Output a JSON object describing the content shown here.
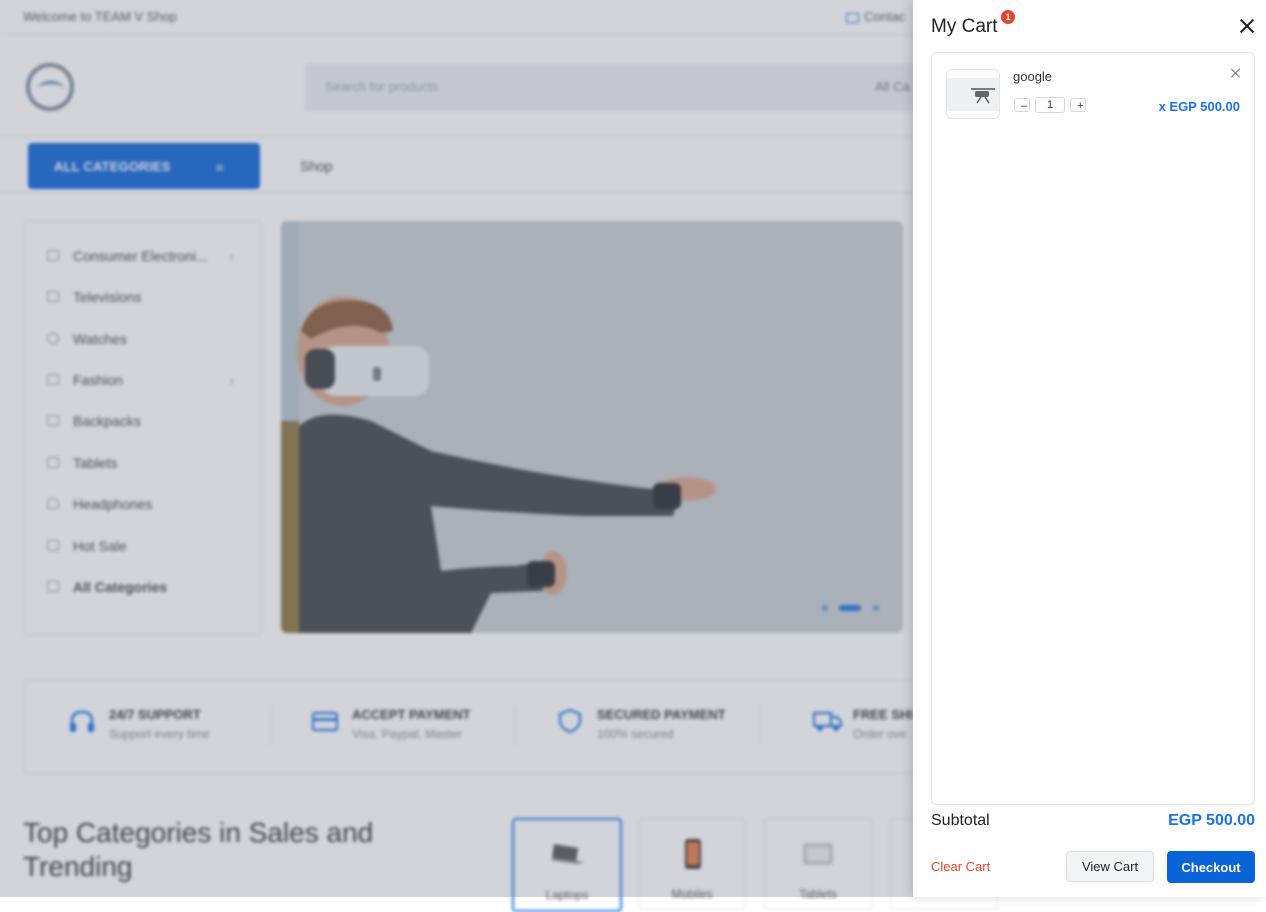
{
  "site": {
    "welcome": "Welcome to TEAM V Shop",
    "contact": "Contac",
    "search": {
      "placeholder": "Search for products",
      "category": "All Ca"
    },
    "nav": {
      "all_categories": "ALL CATEGORIES",
      "shop": "Shop"
    },
    "categories": [
      {
        "label": "Consumer Electroni...",
        "has_children": true
      },
      {
        "label": "Televisions",
        "has_children": false
      },
      {
        "label": "Watches",
        "has_children": false
      },
      {
        "label": "Fashion",
        "has_children": true
      },
      {
        "label": "Backpacks",
        "has_children": false
      },
      {
        "label": "Tablets",
        "has_children": false
      },
      {
        "label": "Headphones",
        "has_children": false
      },
      {
        "label": "Hot Sale",
        "has_children": false
      },
      {
        "label": "All Categories",
        "has_children": false
      }
    ],
    "features": [
      {
        "title": "24/7 SUPPORT",
        "subtitle": "Support every time",
        "icon": "headphones-icon"
      },
      {
        "title": "ACCEPT PAYMENT",
        "subtitle": "Visa, Paypal, Master",
        "icon": "credit-card-icon"
      },
      {
        "title": "SECURED PAYMENT",
        "subtitle": "100% secured",
        "icon": "shield-icon"
      },
      {
        "title": "FREE SHI",
        "subtitle": "Order ove",
        "icon": "truck-icon"
      }
    ],
    "top_categories": {
      "title": "Top Categories in Sales and Trending",
      "cards": [
        {
          "label": "Laptops",
          "icon": "laptop-icon"
        },
        {
          "label": "Mobiles",
          "icon": "phone-icon"
        },
        {
          "label": "Tablets",
          "icon": "tablet-icon"
        }
      ]
    },
    "accent_color": "#0b63d8"
  },
  "cart": {
    "title": "My Cart",
    "badge_count": "1",
    "items": [
      {
        "name": "google",
        "quantity": "1",
        "price": "x EGP 500.00",
        "icon": "drone-icon"
      }
    ],
    "subtotal_label": "Subtotal",
    "subtotal_value": "EGP 500.00",
    "clear_label": "Clear Cart",
    "view_label": "View Cart",
    "checkout_label": "Checkout",
    "price_color": "#1a73e8",
    "danger_color": "#e8432c"
  }
}
